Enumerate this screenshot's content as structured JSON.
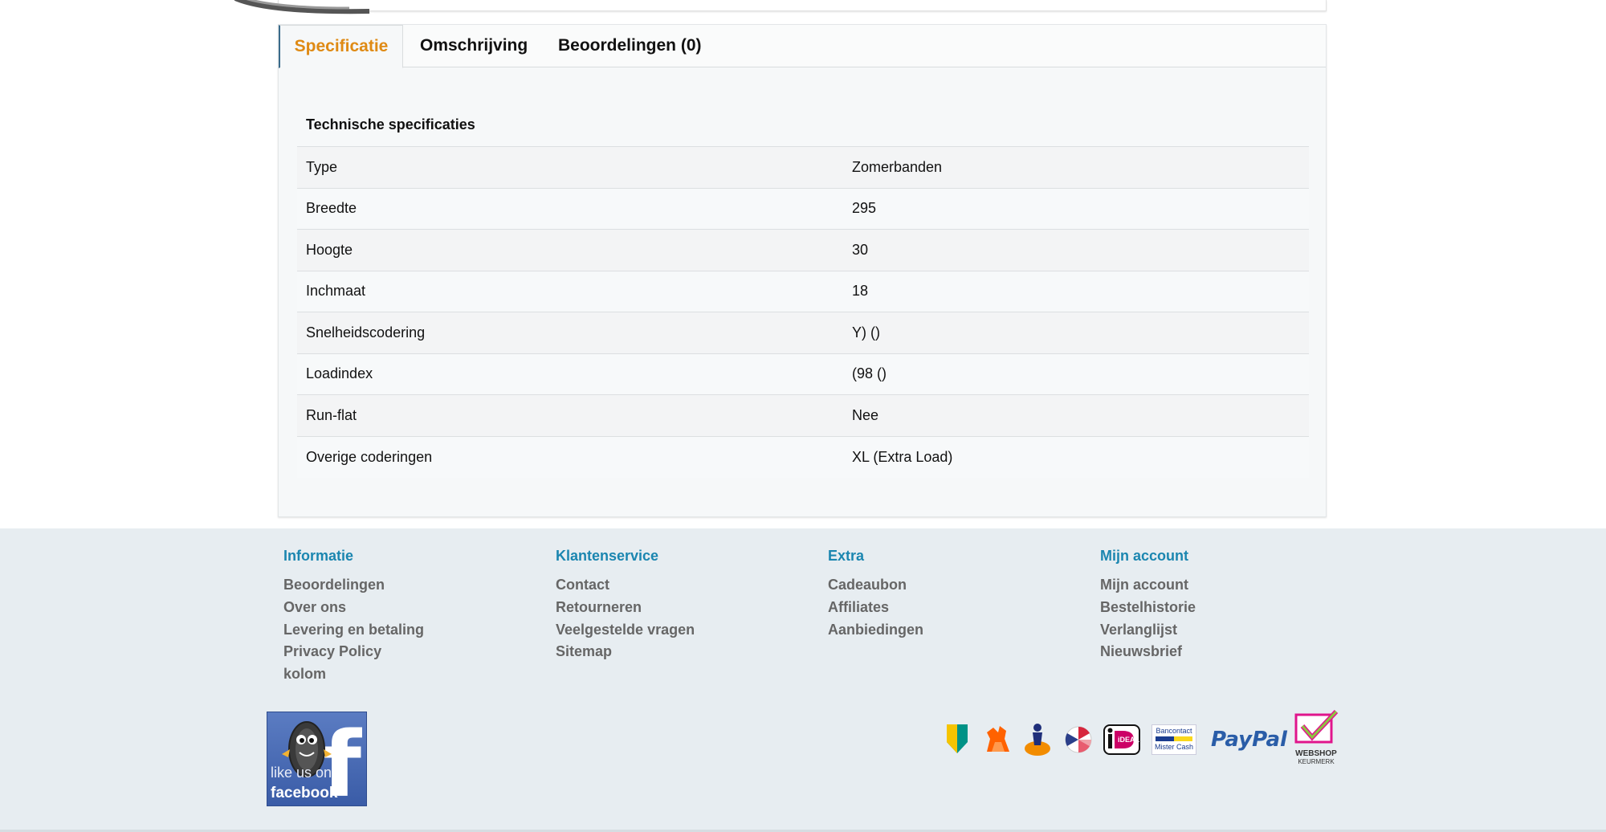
{
  "tabs": [
    {
      "label": "Specificatie",
      "active": true
    },
    {
      "label": "Omschrijving",
      "active": false
    },
    {
      "label": "Beoordelingen (0)",
      "active": false
    }
  ],
  "specs": {
    "title": "Technische specificaties",
    "rows": [
      {
        "key": "Type",
        "value": "Zomerbanden"
      },
      {
        "key": "Breedte",
        "value": "295"
      },
      {
        "key": "Hoogte",
        "value": "30"
      },
      {
        "key": "Inchmaat",
        "value": "18"
      },
      {
        "key": "Snelheidscodering",
        "value": "Y) ()"
      },
      {
        "key": "Loadindex",
        "value": "(98 ()"
      },
      {
        "key": "Run-flat",
        "value": "Nee"
      },
      {
        "key": "Overige coderingen",
        "value": "XL (Extra Load)"
      }
    ]
  },
  "footer": {
    "columns": [
      {
        "heading": "Informatie",
        "links": [
          "Beoordelingen",
          "Over ons",
          "Levering en betaling",
          "Privacy Policy",
          "kolom"
        ]
      },
      {
        "heading": "Klantenservice",
        "links": [
          "Contact",
          "Retourneren",
          "Veelgestelde vragen",
          "Sitemap"
        ]
      },
      {
        "heading": "Extra",
        "links": [
          "Cadeaubon",
          "Affiliates",
          "Aanbiedingen"
        ]
      },
      {
        "heading": "Mijn account",
        "links": [
          "Mijn account",
          "Bestelhistorie",
          "Verlanglijst",
          "Nieuwsbrief"
        ]
      }
    ],
    "facebook": {
      "line1": "like us on",
      "line2": "facebook"
    },
    "payment": {
      "ideal": "iDEAL",
      "bancontact_top": "Bancontact",
      "bancontact_bottom": "Mister Cash",
      "paypal": "PayPal",
      "keurmerk_top": "WEBSHOP",
      "keurmerk_bottom": "KEURMERK"
    }
  },
  "colors": {
    "active_tab": "#df8a14",
    "footer_heading": "#1b86b0",
    "footer_link": "#666666",
    "footer_bg": "#e7edf1"
  }
}
